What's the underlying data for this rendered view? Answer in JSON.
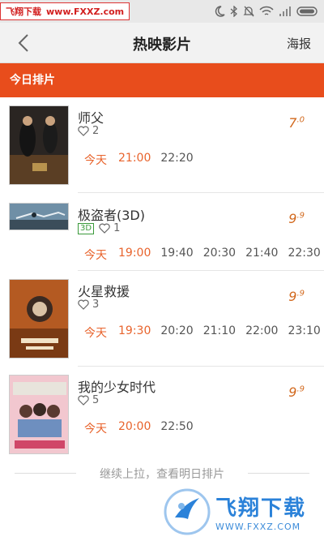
{
  "watermark": {
    "site_name": "飞翔下载",
    "site_url": "www.FXXZ.com",
    "brand": "飞翔下载",
    "brand_url": "WWW.FXXZ.COM"
  },
  "nav": {
    "title": "热映影片",
    "right_label": "海报"
  },
  "section": {
    "title": "今日排片"
  },
  "movies": [
    {
      "title": "师父",
      "likes": "2",
      "score": "7",
      "score_decimal": ".0",
      "day": "今天",
      "times": [
        "21:00",
        "22:20"
      ]
    },
    {
      "title": "极盗者(3D)",
      "badge": "3D",
      "likes": "1",
      "score": "9",
      "score_decimal": ".9",
      "day": "今天",
      "times": [
        "19:00",
        "19:40",
        "20:30",
        "21:40",
        "22:30"
      ]
    },
    {
      "title": "火星救援",
      "likes": "3",
      "score": "9",
      "score_decimal": ".9",
      "day": "今天",
      "times": [
        "19:30",
        "20:20",
        "21:10",
        "22:00",
        "23:10"
      ]
    },
    {
      "title": "我的少女时代",
      "likes": "5",
      "score": "9",
      "score_decimal": ".9",
      "day": "今天",
      "times": [
        "20:00",
        "22:50"
      ]
    }
  ],
  "footer": {
    "text": "继续上拉，查看明日排片"
  },
  "colors": {
    "accent": "#e84d1c",
    "time_highlight": "#e8632c",
    "score": "#d2691e"
  }
}
